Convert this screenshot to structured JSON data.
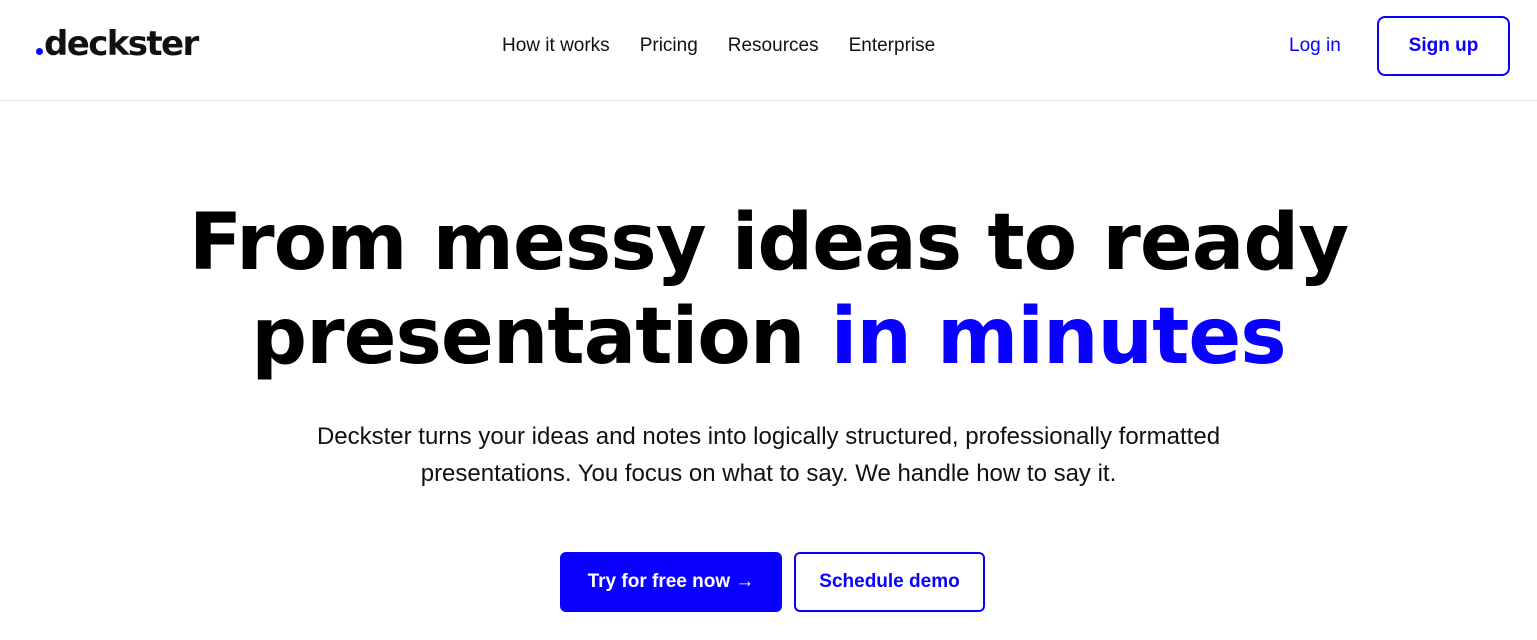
{
  "brand": {
    "name": "deckster",
    "accent_color": "#0a00ff"
  },
  "nav": {
    "items": [
      {
        "label": "How it works"
      },
      {
        "label": "Pricing"
      },
      {
        "label": "Resources"
      },
      {
        "label": "Enterprise"
      }
    ]
  },
  "auth": {
    "login_label": "Log in",
    "signup_label": "Sign up"
  },
  "hero": {
    "title_line1": "From messy ideas to ready",
    "title_line2_plain": "presentation ",
    "title_line2_accent": "in minutes",
    "subtitle_line1": "Deckster turns your ideas and notes into logically structured, professionally formatted",
    "subtitle_line2": "presentations. You focus on what to say. We handle how to say it."
  },
  "cta": {
    "primary_label": "Try for free now →",
    "secondary_label": "Schedule demo"
  }
}
